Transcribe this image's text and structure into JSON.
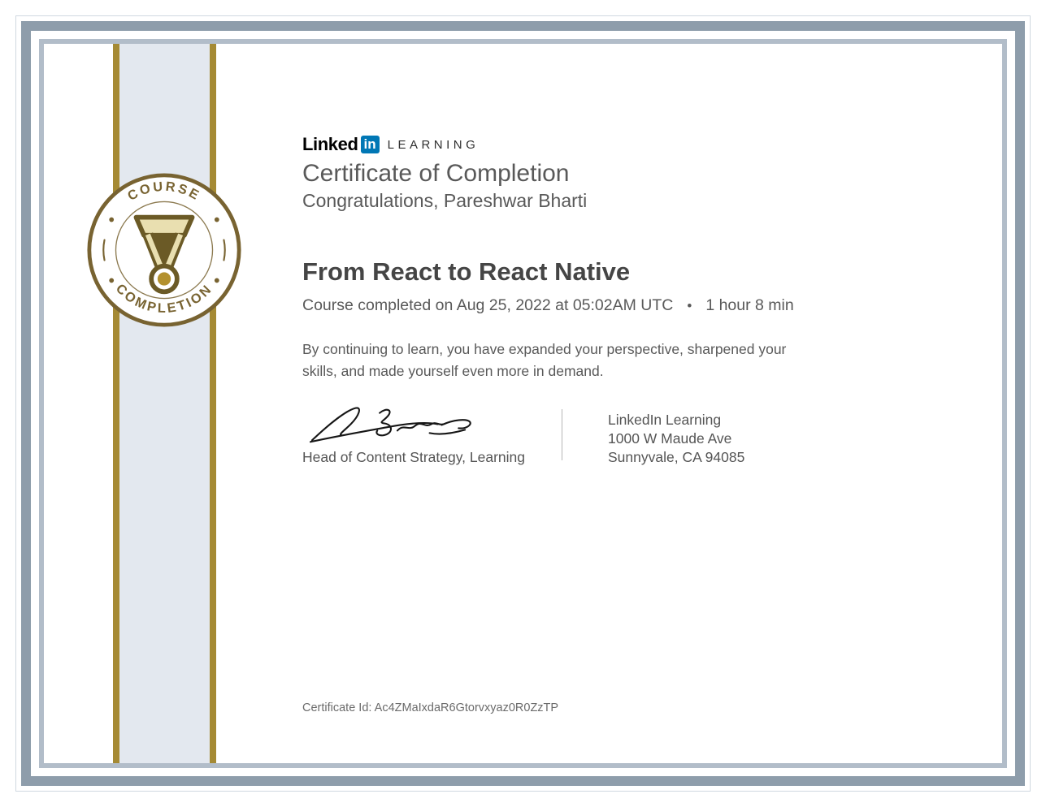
{
  "colors": {
    "frame_outer_line": "#d0d8e0",
    "frame_dark": "#8e9dab",
    "frame_light": "#b2bdc9",
    "band_gold": "#a58a34",
    "band_panel": "#e3e8ef",
    "badge_gold": "#786331",
    "medal_dark": "#6b5a26",
    "medal_light": "#e9dfb0",
    "medal_gold_dot": "#b3912f",
    "logo_blue": "#0077b5"
  },
  "logo": {
    "linked": "Linked",
    "in": "in",
    "learning": "LEARNING"
  },
  "badge": {
    "top": "COURSE",
    "bottom": "COMPLETION"
  },
  "header": {
    "title": "Certificate of Completion",
    "greeting": "Congratulations, Pareshwar Bharti"
  },
  "course": {
    "title": "From React to React Native",
    "completion": "Course completed on Aug 25, 2022 at 05:02AM UTC",
    "bullet": "•",
    "duration": "1 hour 8 min"
  },
  "message": "By continuing to learn, you have expanded your perspective, sharpened your skills, and made yourself even more in demand.",
  "signer": {
    "title": "Head of Content Strategy, Learning"
  },
  "issuer": {
    "name": "LinkedIn Learning",
    "street": "1000 W Maude Ave",
    "city": "Sunnyvale, CA 94085"
  },
  "footer": {
    "certificate_id": "Certificate Id: Ac4ZMaIxdaR6Gtorvxyaz0R0ZzTP"
  }
}
